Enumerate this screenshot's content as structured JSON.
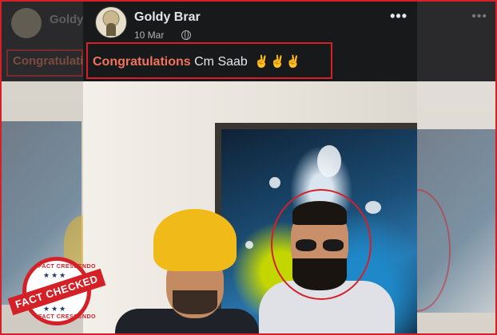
{
  "post": {
    "author": "Goldy Brar",
    "date": "10 Mar",
    "caption_highlight": "Congratulations",
    "caption_rest": "Cm Saab",
    "caption_emoji": "✌✌✌",
    "more_label": "•••"
  },
  "blurred_background": {
    "name": "Goldy",
    "text": "Congratulations"
  },
  "stamp": {
    "top_text": "FACT CRESCENDO",
    "banner_text": "FACT CHECKED",
    "bottom_text": "FACT CRESCENDO",
    "stars": "★★★"
  },
  "colors": {
    "highlight_red": "#d42027",
    "caption_orange": "#f1735c",
    "turban_yellow": "#f0bb18",
    "post_background": "#18191a"
  },
  "icons": [
    "globe-icon",
    "more-options-icon",
    "victory-hand-emoji"
  ]
}
